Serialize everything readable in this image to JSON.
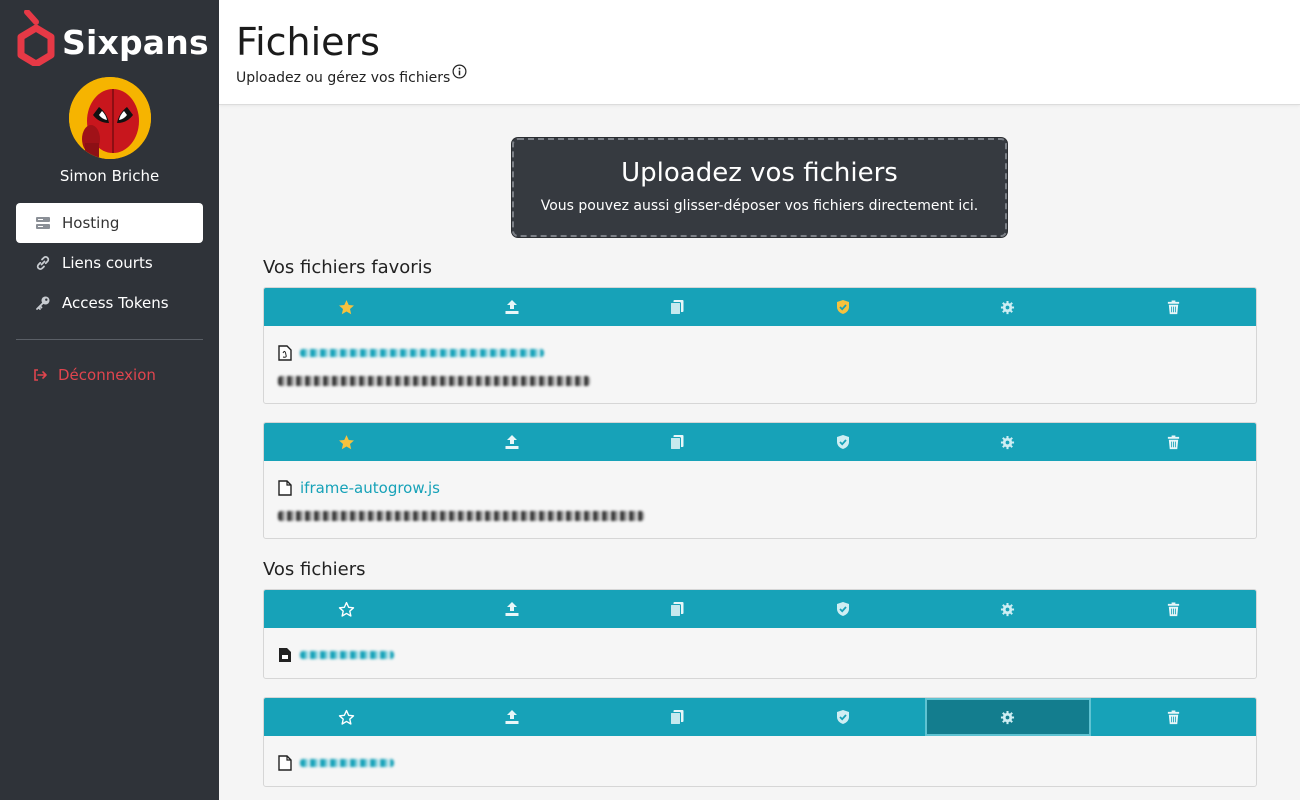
{
  "app": {
    "name": "Sixpans",
    "brand_color": "#e63946"
  },
  "user": {
    "name": "Simon Briche"
  },
  "sidebar": {
    "items": [
      {
        "label": "Hosting",
        "icon": "server-icon",
        "active": true
      },
      {
        "label": "Liens courts",
        "icon": "link-icon",
        "active": false
      },
      {
        "label": "Access Tokens",
        "icon": "key-icon",
        "active": false
      }
    ],
    "logout_label": "Déconnexion"
  },
  "header": {
    "title": "Fichiers",
    "subtitle": "Uploadez ou gérez vos fichiers"
  },
  "upload": {
    "title": "Uploadez vos fichiers",
    "subtitle": "Vous pouvez aussi glisser-déposer vos fichiers directement ici."
  },
  "sections": {
    "favorites_title": "Vos fichiers favoris",
    "files_title": "Vos fichiers"
  },
  "toolbar_icons": [
    "star-icon",
    "upload-icon",
    "copy-icon",
    "shield-icon",
    "gear-icon",
    "trash-icon"
  ],
  "files": [
    {
      "section": "favorites",
      "name": "",
      "name_redacted": true,
      "description_redacted": true,
      "favorite": true,
      "protected": true,
      "file_icon": "pdf-file-icon"
    },
    {
      "section": "favorites",
      "name": "iframe-autogrow.js",
      "name_redacted": false,
      "description_redacted": true,
      "favorite": true,
      "protected": false,
      "file_icon": "file-icon"
    },
    {
      "section": "files",
      "name": "",
      "name_redacted": true,
      "description_redacted": false,
      "favorite": false,
      "protected": false,
      "file_icon": "media-file-icon"
    },
    {
      "section": "files",
      "name": "",
      "name_redacted": true,
      "description_redacted": false,
      "favorite": false,
      "protected": false,
      "file_icon": "file-icon"
    }
  ],
  "colors": {
    "sidebar_bg": "#2f3339",
    "toolbar_bg": "#17a2b8",
    "favorite_star": "#f6c23e",
    "protected_shield": "#f6c23e",
    "logout": "#e0454e"
  }
}
